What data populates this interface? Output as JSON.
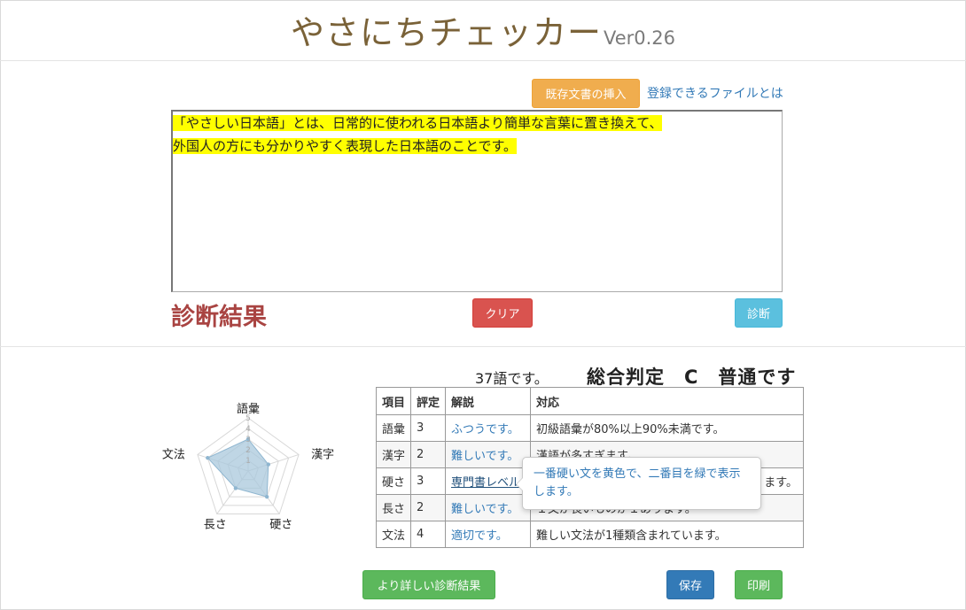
{
  "header": {
    "title": "やさにちチェッカー",
    "version": "Ver0.26"
  },
  "toolbar": {
    "insert_button": "既存文書の挿入",
    "file_link": "登録できるファイルとは"
  },
  "editor": {
    "lines": [
      "「やさしい日本語」とは、日常的に使われる日本語より簡単な言葉に置き換えて、",
      "外国人の方にも分かりやすく表現した日本語のことです。"
    ],
    "highlight_color": "#ffff00"
  },
  "diagnosis": {
    "title": "診断結果",
    "clear_button": "クリア",
    "diagnose_button": "診断"
  },
  "summary": {
    "word_count": "37語です。",
    "overall": "総合判定　C　普通です"
  },
  "radar": {
    "axes": [
      "語彙",
      "漢字",
      "硬さ",
      "長さ",
      "文法"
    ],
    "ticks": [
      "1",
      "2",
      "3",
      "4",
      "5"
    ],
    "values": [
      3,
      2,
      3,
      2,
      4
    ],
    "max": 5,
    "fill_color": "#a9c8dc"
  },
  "table": {
    "headers": [
      "項目",
      "評定",
      "解説",
      "対応"
    ],
    "rows": [
      {
        "item": "語彙",
        "score": "3",
        "explain": "ふつうです。",
        "action": "初級語彙が80%以上90%未満です。"
      },
      {
        "item": "漢字",
        "score": "2",
        "explain": "難しいです。",
        "action": "漢語が多すぎます。"
      },
      {
        "item": "硬さ",
        "score": "3",
        "explain": "専門書レベル",
        "action": "ます。"
      },
      {
        "item": "長さ",
        "score": "2",
        "explain": "難しいです。",
        "action": "１文が長いものが１あります。"
      },
      {
        "item": "文法",
        "score": "4",
        "explain": "適切です。",
        "action": "難しい文法が1種類含まれています。"
      }
    ]
  },
  "tooltip": {
    "text": "一番硬い文を黄色で、二番目を緑で表示します。"
  },
  "footer": {
    "more_button": "より詳しい診断結果",
    "save_button": "保存",
    "print_button": "印刷"
  },
  "colors": {
    "title": "#7a6238",
    "warning": "#f0ad4e",
    "danger": "#d9534f",
    "info": "#5bc0de",
    "primary": "#337ab7",
    "success": "#5cb85c",
    "diag_title": "#a94442"
  }
}
